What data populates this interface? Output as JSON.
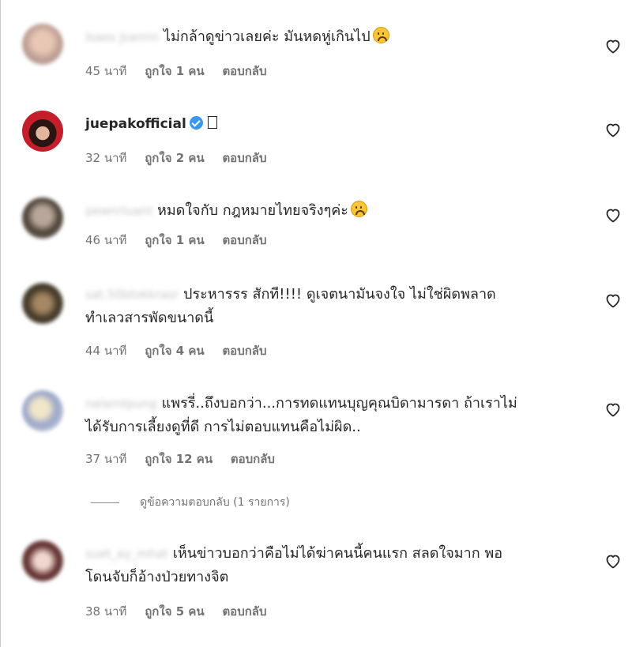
{
  "comments": [
    {
      "username": "Isaes Jsamin",
      "text": "ไม่กล้าดูข่าวเลยค่ะ มันหดหู่เกินไป",
      "emoji": "sad-face",
      "time": "45 นาที",
      "likes": "ถูกใจ 1 คน",
      "reply": "ตอบกลับ"
    },
    {
      "username": "juepakofficial",
      "verified": true,
      "text": "",
      "symbol": "missing-glyph-box",
      "time": "32 นาที",
      "likes": "ถูกใจ 2 คน",
      "reply": "ตอบกลับ"
    },
    {
      "username": "pewnrluant",
      "text": "หมดใจกับ กฎหมายไทยจริงๆค่ะ",
      "emoji": "sad-face",
      "time": "46 นาที",
      "likes": "ถูกใจ 1 คน",
      "reply": "ตอบกลับ"
    },
    {
      "username": "sat.50btokkrasr",
      "text_line1": "ประหารรร สักที!!!! ดูเจตนามันจงใจ ไม่ใช่ผิดพลาด",
      "text_line2": "ทำเลวสารพัดขนาดนี้",
      "time": "44 นาที",
      "likes": "ถูกใจ 4 คน",
      "reply": "ตอบกลับ"
    },
    {
      "username": "nalamtpung",
      "text_line1": "แพรรี่..ถึงบอกว่า...การทดแทนบุญคุณบิดามารดา ถ้าเราไม่",
      "text_line2": "ได้รับการเลี้ยงดูที่ดี การไม่ตอบแทนคือไม่ผิด..",
      "time": "37 นาที",
      "likes": "ถูกใจ 12 คน",
      "reply": "ตอบกลับ"
    },
    {
      "username": "suet_ay_mhat",
      "text_line1": "เห็นข่าวบอกว่าคือไม่ได้ฆ่าคนนี้คนแรก สลดใจมาก พอ",
      "text_line2": "โดนจับก็อ้างป่วยทางจิต",
      "time": "38 นาที",
      "likes": "ถูกใจ 5 คน",
      "reply": "ตอบกลับ"
    }
  ],
  "view_replies": "ดูข้อความตอบกลับ (1 รายการ)",
  "colors": {
    "text": "#262626",
    "meta": "#737373",
    "verified": "#3897f0"
  },
  "icons": [
    "heart-outline-icon",
    "verified-badge-icon",
    "sad-face-emoji"
  ]
}
